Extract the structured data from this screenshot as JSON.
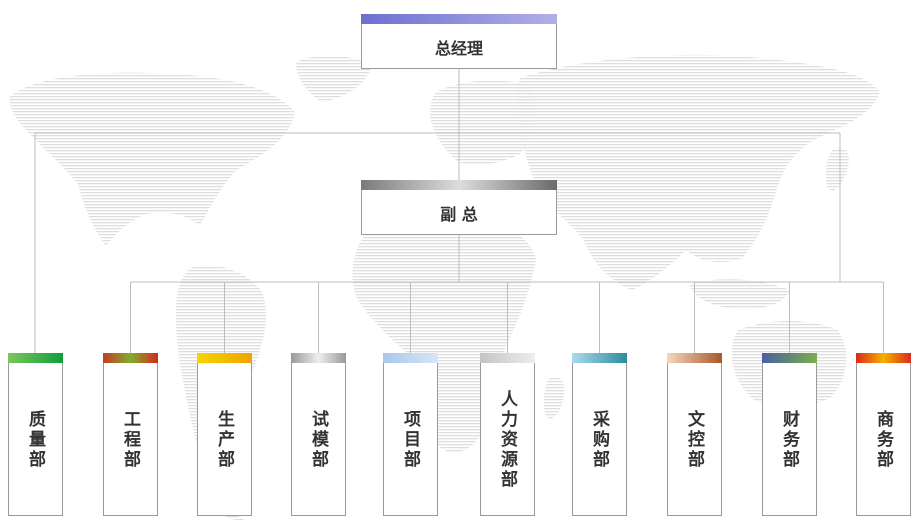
{
  "general_manager": {
    "label": "总经理"
  },
  "deputy_gm": {
    "label": "副 总"
  },
  "departments": [
    {
      "label": "质量部",
      "bar": [
        "#7cc65a",
        "#0f9e3c"
      ]
    },
    {
      "label": "工程部",
      "bar": [
        "#c83a26",
        "#7fae2e",
        "#d8281c"
      ]
    },
    {
      "label": "生产部",
      "bar": [
        "#f7d400",
        "#f0a300"
      ]
    },
    {
      "label": "试模部",
      "bar": [
        "#999999",
        "#eeeeee",
        "#999999"
      ]
    },
    {
      "label": "项目部",
      "bar": [
        "#a8c8ec",
        "#d6e6f7"
      ]
    },
    {
      "label": "人力资源部",
      "bar": [
        "#c4c4c4",
        "#eeeeee"
      ]
    },
    {
      "label": "采购部",
      "bar": [
        "#a8dcec",
        "#2e8a9e"
      ]
    },
    {
      "label": "文控部",
      "bar": [
        "#f6d6be",
        "#a8582a"
      ]
    },
    {
      "label": "财务部",
      "bar": [
        "#4a5ea2",
        "#7ab04a"
      ]
    },
    {
      "label": "商务部",
      "bar": [
        "#d82a1a",
        "#f7b000",
        "#d82a1a"
      ]
    }
  ],
  "colors": {
    "gm_bar": [
      "#6e6ed2",
      "#b0b0e8"
    ],
    "deputy_bar": [
      "#7a7a7a",
      "#dddddd",
      "#6a6a6a"
    ],
    "line": "#bdbdbd",
    "map": "#e3e3e3"
  }
}
